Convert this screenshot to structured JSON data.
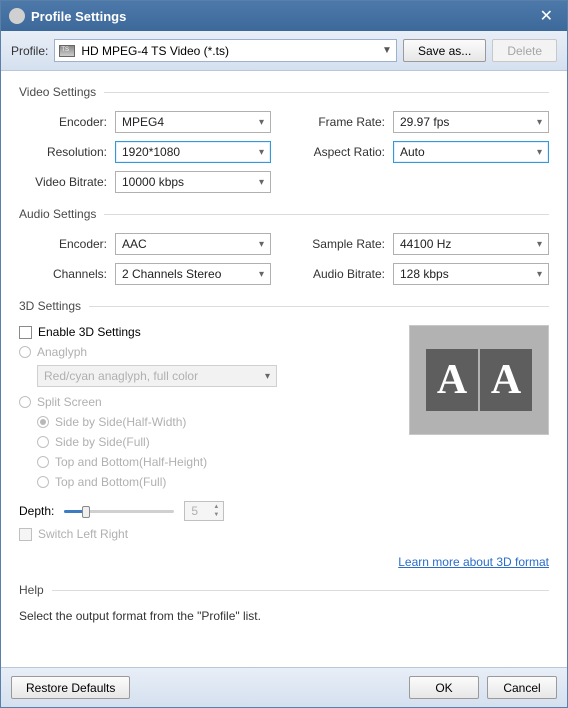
{
  "window": {
    "title": "Profile Settings"
  },
  "profilebar": {
    "label": "Profile:",
    "value": "HD MPEG-4 TS Video (*.ts)",
    "save_as": "Save as...",
    "delete": "Delete"
  },
  "video": {
    "group_title": "Video Settings",
    "encoder_label": "Encoder:",
    "encoder_value": "MPEG4",
    "framerate_label": "Frame Rate:",
    "framerate_value": "29.97 fps",
    "resolution_label": "Resolution:",
    "resolution_value": "1920*1080",
    "aspect_label": "Aspect Ratio:",
    "aspect_value": "Auto",
    "bitrate_label": "Video Bitrate:",
    "bitrate_value": "10000 kbps"
  },
  "audio": {
    "group_title": "Audio Settings",
    "encoder_label": "Encoder:",
    "encoder_value": "AAC",
    "samplerate_label": "Sample Rate:",
    "samplerate_value": "44100 Hz",
    "channels_label": "Channels:",
    "channels_value": "2 Channels Stereo",
    "bitrate_label": "Audio Bitrate:",
    "bitrate_value": "128 kbps"
  },
  "threeD": {
    "group_title": "3D Settings",
    "enable_label": "Enable 3D Settings",
    "anaglyph_label": "Anaglyph",
    "anaglyph_value": "Red/cyan anaglyph, full color",
    "split_label": "Split Screen",
    "opt1": "Side by Side(Half-Width)",
    "opt2": "Side by Side(Full)",
    "opt3": "Top and Bottom(Half-Height)",
    "opt4": "Top and Bottom(Full)",
    "depth_label": "Depth:",
    "depth_value": "5",
    "switch_label": "Switch Left Right",
    "learn_more": "Learn more about 3D format",
    "preview_a": "A",
    "preview_b": "A"
  },
  "help": {
    "group_title": "Help",
    "text": "Select the output format from the \"Profile\" list."
  },
  "bottom": {
    "restore": "Restore Defaults",
    "ok": "OK",
    "cancel": "Cancel"
  }
}
